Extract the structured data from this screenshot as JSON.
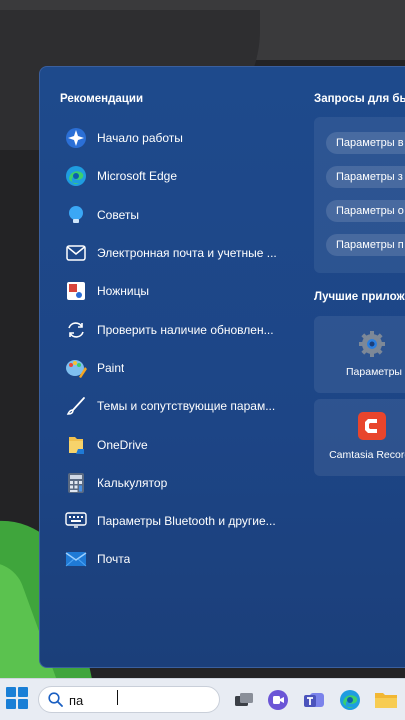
{
  "recommendations": {
    "title": "Рекомендации",
    "items": [
      {
        "label": "Начало работы",
        "icon": "get-started-icon"
      },
      {
        "label": "Microsoft Edge",
        "icon": "edge-icon"
      },
      {
        "label": "Советы",
        "icon": "tips-icon"
      },
      {
        "label": "Электронная почта и учетные ...",
        "icon": "mail-accounts-icon"
      },
      {
        "label": "Ножницы",
        "icon": "snipping-tool-icon"
      },
      {
        "label": "Проверить наличие обновлен...",
        "icon": "update-icon"
      },
      {
        "label": "Paint",
        "icon": "paint-icon"
      },
      {
        "label": "Темы и сопутствующие парам...",
        "icon": "themes-brush-icon"
      },
      {
        "label": "OneDrive",
        "icon": "onedrive-icon"
      },
      {
        "label": "Калькулятор",
        "icon": "calculator-icon"
      },
      {
        "label": "Параметры Bluetooth и другие...",
        "icon": "bluetooth-settings-icon"
      },
      {
        "label": "Почта",
        "icon": "mail-icon"
      }
    ]
  },
  "queries": {
    "title": "Запросы для быс",
    "items": [
      "Параметры в",
      "Параметры з",
      "Параметры о",
      "Параметры п"
    ]
  },
  "best_apps": {
    "title": "Лучшие прилож",
    "items": [
      {
        "label": "Параметры",
        "icon": "settings-gear-icon"
      },
      {
        "label": "Camtasia Record...",
        "icon": "camtasia-icon"
      }
    ]
  },
  "taskbar": {
    "search_value": "па"
  },
  "colors": {
    "panel": "#1e4a8c",
    "taskbar": "#e8ecf3",
    "accent": "#1a7fd6"
  }
}
